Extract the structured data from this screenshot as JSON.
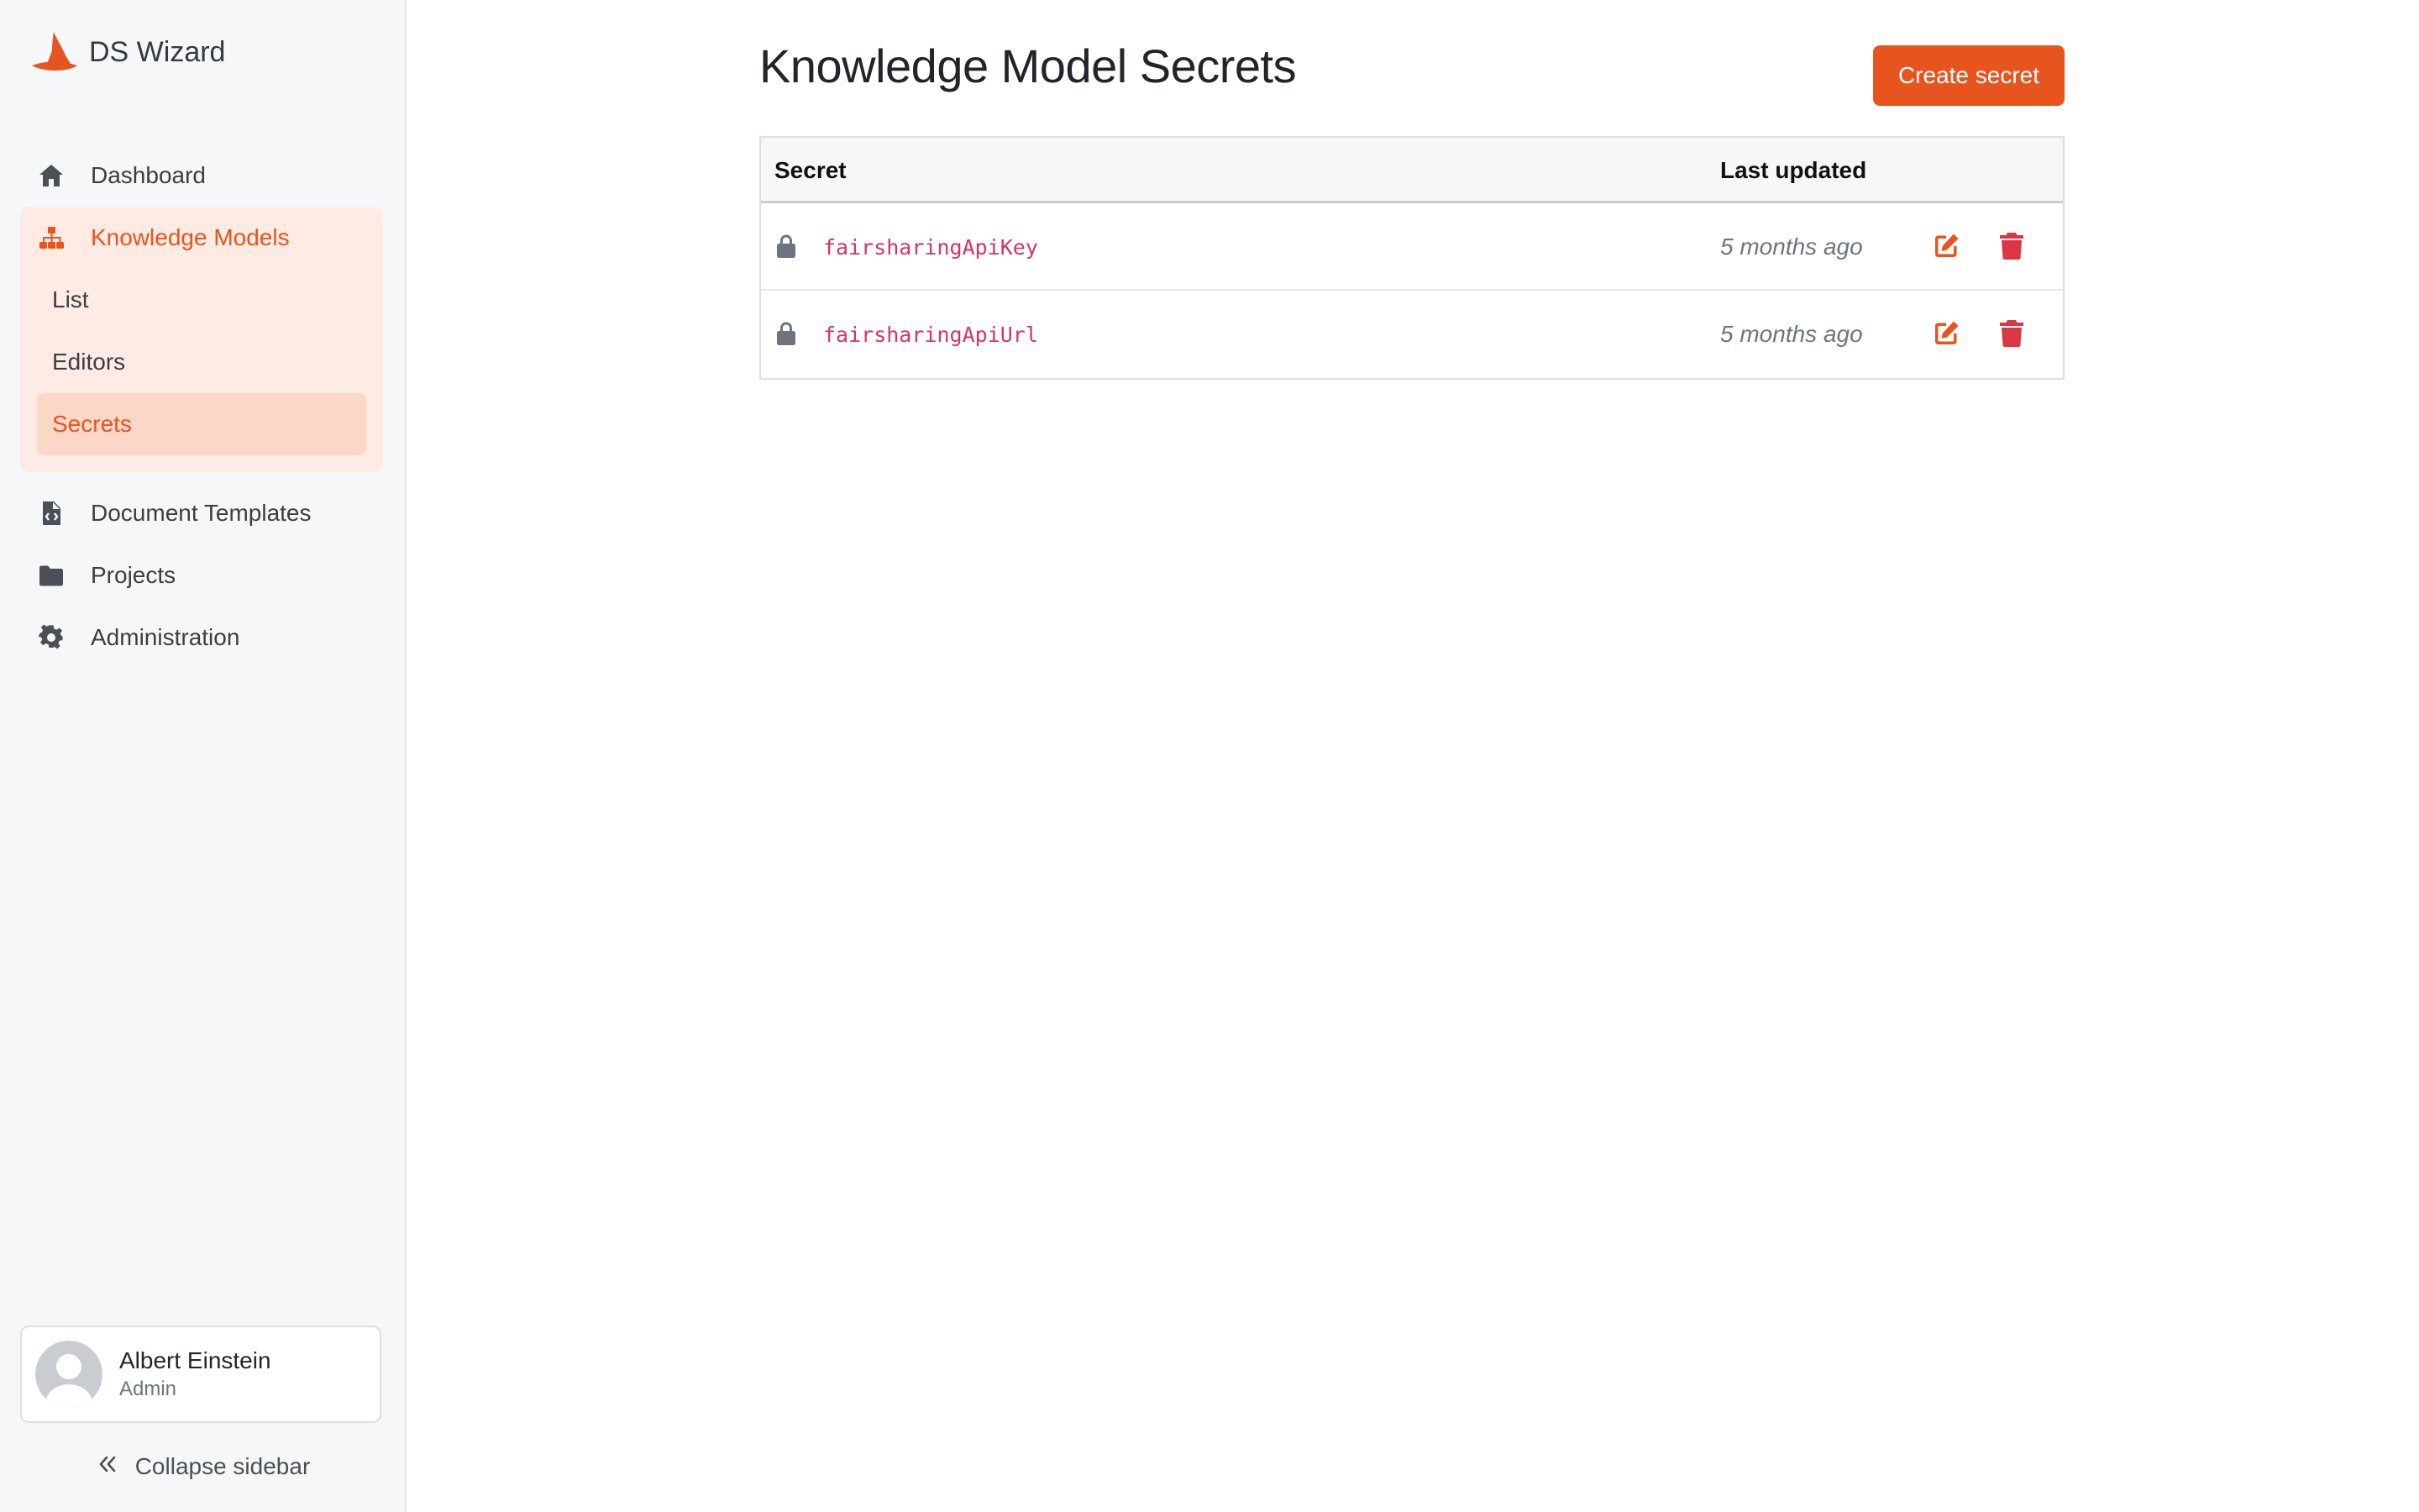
{
  "app": {
    "name": "DS Wizard"
  },
  "sidebar": {
    "items": [
      {
        "label": "Dashboard",
        "icon": "house-icon"
      },
      {
        "label": "Knowledge Models",
        "icon": "sitemap-icon",
        "active": true,
        "subitems": [
          {
            "label": "List"
          },
          {
            "label": "Editors"
          },
          {
            "label": "Secrets",
            "active": true
          }
        ]
      },
      {
        "label": "Document Templates",
        "icon": "file-code-icon"
      },
      {
        "label": "Projects",
        "icon": "folder-icon"
      },
      {
        "label": "Administration",
        "icon": "gear-icon"
      }
    ],
    "profile": {
      "name": "Albert Einstein",
      "role": "Admin"
    },
    "collapse_label": "Collapse sidebar"
  },
  "main": {
    "title": "Knowledge Model Secrets",
    "create_button": "Create secret",
    "table": {
      "columns": [
        "Secret",
        "Last updated"
      ],
      "rows": [
        {
          "name": "fairsharingApiKey",
          "updated": "5 months ago"
        },
        {
          "name": "fairsharingApiUrl",
          "updated": "5 months ago"
        }
      ]
    }
  },
  "colors": {
    "accent": "#e8541e",
    "accent_light_bg": "#fdebe4",
    "danger": "#dc3545",
    "code": "#d6336c",
    "sidebar_bg": "#f6f7f8"
  }
}
